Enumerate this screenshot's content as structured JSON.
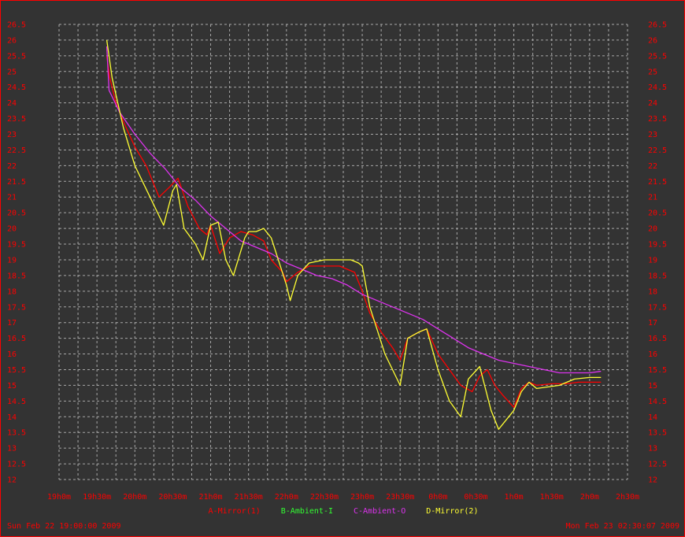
{
  "chart_data": {
    "type": "line",
    "grid": true,
    "ylim": [
      12,
      26.5
    ],
    "yticks": [
      "12",
      "12.5",
      "13",
      "13.5",
      "14",
      "14.5",
      "15",
      "15.5",
      "16",
      "16.5",
      "17",
      "17.5",
      "18",
      "18.5",
      "19",
      "19.5",
      "20",
      "20.5",
      "21",
      "21.5",
      "22",
      "22.5",
      "23",
      "23.5",
      "24",
      "24.5",
      "25",
      "25.5",
      "26",
      "26.5"
    ],
    "x_unit": "hours since 19h0m",
    "xlim": [
      0,
      7.5
    ],
    "xticks": [
      {
        "x": 0,
        "label": "19h0m"
      },
      {
        "x": 0.5,
        "label": "19h30m"
      },
      {
        "x": 1,
        "label": "20h0m"
      },
      {
        "x": 1.5,
        "label": "20h30m"
      },
      {
        "x": 2,
        "label": "21h0m"
      },
      {
        "x": 2.5,
        "label": "21h30m"
      },
      {
        "x": 3,
        "label": "22h0m"
      },
      {
        "x": 3.5,
        "label": "22h30m"
      },
      {
        "x": 4,
        "label": "23h0m"
      },
      {
        "x": 4.5,
        "label": "23h30m"
      },
      {
        "x": 5,
        "label": "0h0m"
      },
      {
        "x": 5.5,
        "label": "0h30m"
      },
      {
        "x": 6,
        "label": "1h0m"
      },
      {
        "x": 6.5,
        "label": "1h30m"
      },
      {
        "x": 7,
        "label": "2h0m"
      },
      {
        "x": 7.5,
        "label": "2h30m"
      }
    ],
    "series": [
      {
        "name": "A-Mirror(1)",
        "color": "#ff0000",
        "x": [
          0.63,
          0.67,
          0.75,
          0.85,
          1.0,
          1.15,
          1.32,
          1.45,
          1.57,
          1.7,
          1.85,
          1.95,
          2.0,
          2.12,
          2.25,
          2.4,
          2.55,
          2.7,
          2.8,
          2.95,
          3.0,
          3.15,
          3.3,
          3.5,
          3.7,
          3.9,
          4.0,
          4.1,
          4.25,
          4.4,
          4.5,
          4.6,
          4.75,
          4.85,
          5.0,
          5.15,
          5.3,
          5.45,
          5.55,
          5.65,
          5.75,
          5.85,
          6.0,
          6.1,
          6.2,
          6.3,
          6.5,
          6.7,
          6.85,
          7.0,
          7.15
        ],
        "y": [
          25.5,
          24.8,
          24.0,
          23.4,
          22.6,
          22.0,
          21.0,
          21.3,
          21.6,
          20.7,
          20.0,
          19.8,
          20.1,
          19.2,
          19.7,
          19.9,
          19.8,
          19.6,
          19.0,
          18.6,
          18.3,
          18.6,
          18.8,
          18.8,
          18.8,
          18.6,
          18.0,
          17.3,
          16.7,
          16.2,
          15.8,
          16.5,
          16.7,
          16.8,
          16.0,
          15.5,
          15.0,
          14.8,
          15.3,
          15.5,
          15.0,
          14.7,
          14.3,
          14.9,
          15.1,
          15.0,
          15.05,
          15.05,
          15.1,
          15.1,
          15.1
        ]
      },
      {
        "name": "C-Ambient-O",
        "color": "#dd33ee",
        "x": [
          0.63,
          0.66,
          0.8,
          1.0,
          1.2,
          1.4,
          1.6,
          1.8,
          2.0,
          2.2,
          2.4,
          2.6,
          2.8,
          3.0,
          3.2,
          3.4,
          3.6,
          3.8,
          4.0,
          4.2,
          4.4,
          4.6,
          4.8,
          5.0,
          5.2,
          5.4,
          5.6,
          5.8,
          6.0,
          6.2,
          6.4,
          6.6,
          6.8,
          7.0,
          7.15
        ],
        "y": [
          25.8,
          24.4,
          23.7,
          23.0,
          22.4,
          21.9,
          21.3,
          20.9,
          20.4,
          20.0,
          19.6,
          19.4,
          19.2,
          18.9,
          18.7,
          18.5,
          18.4,
          18.2,
          17.9,
          17.7,
          17.5,
          17.3,
          17.1,
          16.8,
          16.5,
          16.2,
          16.0,
          15.8,
          15.7,
          15.6,
          15.5,
          15.4,
          15.4,
          15.4,
          15.45
        ]
      },
      {
        "name": "D-Mirror(2)",
        "color": "#ffff33",
        "x": [
          0.63,
          0.7,
          0.85,
          1.0,
          1.2,
          1.38,
          1.5,
          1.55,
          1.65,
          1.8,
          1.9,
          2.0,
          2.1,
          2.2,
          2.3,
          2.45,
          2.5,
          2.6,
          2.7,
          2.8,
          3.0,
          3.05,
          3.15,
          3.3,
          3.5,
          3.7,
          3.85,
          3.95,
          4.0,
          4.1,
          4.3,
          4.5,
          4.6,
          4.75,
          4.85,
          5.0,
          5.15,
          5.3,
          5.4,
          5.55,
          5.7,
          5.8,
          6.0,
          6.1,
          6.2,
          6.3,
          6.6,
          6.8,
          7.0,
          7.15
        ],
        "y": [
          26.0,
          24.8,
          23.2,
          22.0,
          21.0,
          20.1,
          21.2,
          21.4,
          20.0,
          19.5,
          19.0,
          20.1,
          20.2,
          19.0,
          18.5,
          19.7,
          19.9,
          19.9,
          20.0,
          19.7,
          18.2,
          17.7,
          18.5,
          18.9,
          19.0,
          19.0,
          19.0,
          18.9,
          18.8,
          17.5,
          16.0,
          15.0,
          16.5,
          16.7,
          16.8,
          15.5,
          14.5,
          14.0,
          15.2,
          15.6,
          14.2,
          13.6,
          14.2,
          14.8,
          15.1,
          14.9,
          15.0,
          15.2,
          15.25,
          15.25
        ]
      }
    ],
    "legend": [
      {
        "label": "A-Mirror(1)",
        "color": "#ff0000"
      },
      {
        "label": "B-Ambient-I",
        "color": "#33ff33"
      },
      {
        "label": "C-Ambient-O",
        "color": "#dd33ee"
      },
      {
        "label": "D-Mirror(2)",
        "color": "#ffff33"
      }
    ]
  },
  "footer": {
    "left": "Sun Feb 22 19:00:00 2009",
    "right": "Mon Feb 23 02:30:07 2009"
  }
}
